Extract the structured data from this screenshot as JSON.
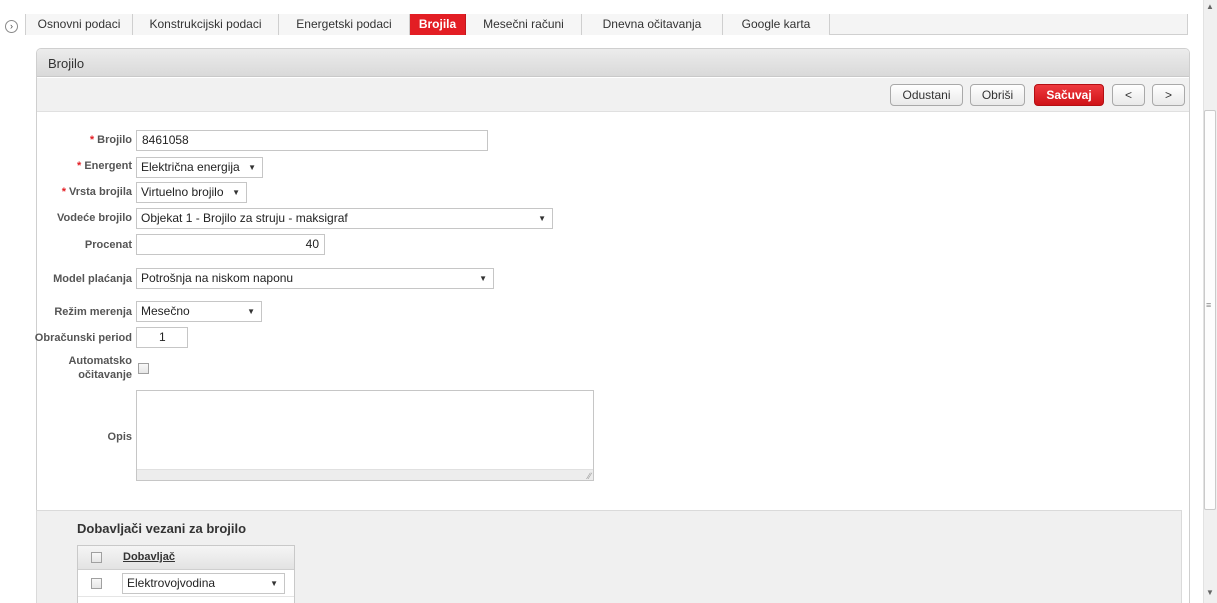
{
  "tabs": [
    {
      "label": "Osnovni podaci",
      "active": false
    },
    {
      "label": "Konstrukcijski podaci",
      "active": false
    },
    {
      "label": "Energetski podaci",
      "active": false
    },
    {
      "label": "Brojila",
      "active": true
    },
    {
      "label": "Mesečni računi",
      "active": false
    },
    {
      "label": "Dnevna očitavanja",
      "active": false
    },
    {
      "label": "Google karta",
      "active": false
    }
  ],
  "panel": {
    "title": "Brojilo"
  },
  "toolbar": {
    "cancel_label": "Odustani",
    "delete_label": "Obriši",
    "save_label": "Sačuvaj",
    "prev_label": "<",
    "next_label": ">"
  },
  "form": {
    "brojilo": {
      "label": "Brojilo",
      "value": "8461058",
      "required": true
    },
    "energent": {
      "label": "Energent",
      "value": "Električna energija",
      "required": true
    },
    "vrsta_brojila": {
      "label": "Vrsta brojila",
      "value": "Virtuelno brojilo",
      "required": true
    },
    "vodece_brojilo": {
      "label": "Vodeće brojilo",
      "value": "Objekat 1 - Brojilo za struju - maksigraf"
    },
    "procenat": {
      "label": "Procenat",
      "value": "40"
    },
    "model_placanja": {
      "label": "Model plaćanja",
      "value": "Potrošnja na niskom naponu"
    },
    "rezim_merenja": {
      "label": "Režim merenja",
      "value": "Mesečno"
    },
    "obracunski_period": {
      "label": "Obračunski period",
      "value": "1"
    },
    "automatsko_ocitavanje": {
      "label_line1": "Automatsko",
      "label_line2": "očitavanje",
      "checked": false
    },
    "opis": {
      "label": "Opis",
      "value": ""
    }
  },
  "suppliers": {
    "title": "Dobavljači vezani za brojilo",
    "column_header": "Dobavljač",
    "rows": [
      {
        "value": "Elektrovojvodina",
        "checked": false
      }
    ]
  },
  "colors": {
    "accent": "#e31e24",
    "panel_header": "#dedede"
  }
}
